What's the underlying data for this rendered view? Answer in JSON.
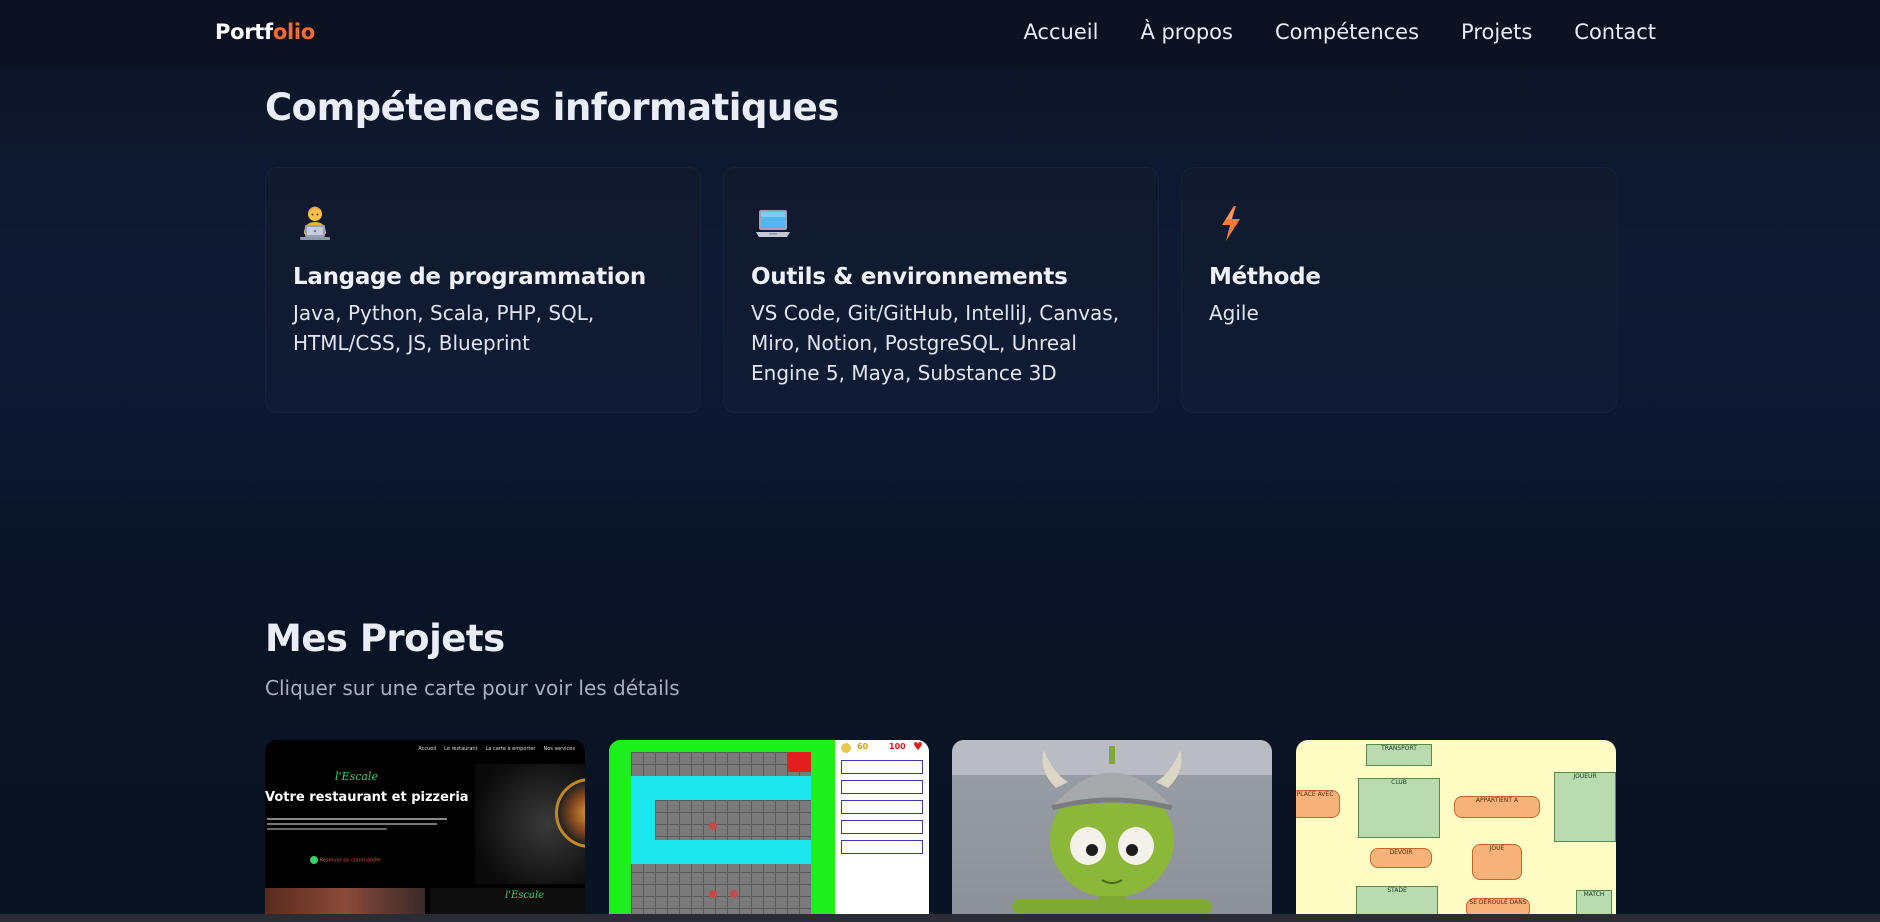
{
  "nav": {
    "logo_part1": "Portf",
    "logo_part2": "olio",
    "links": [
      "Accueil",
      "À propos",
      "Compétences",
      "Projets",
      "Contact"
    ]
  },
  "skills": {
    "title": "Compétences informatiques",
    "cards": [
      {
        "icon": "technologist-icon",
        "title": "Langage de programmation",
        "text": "Java, Python, Scala, PHP, SQL, HTML/CSS, JS, Blueprint"
      },
      {
        "icon": "laptop-icon",
        "title": "Outils & environnements",
        "text": "VS Code, Git/GitHub, IntelliJ, Canvas, Miro, Notion, PostgreSQL, Unreal Engine 5, Maya, Substance 3D"
      },
      {
        "icon": "lightning-icon",
        "title": "Méthode",
        "text": "Agile"
      }
    ]
  },
  "projects": {
    "title": "Mes Projets",
    "subtitle": "Cliquer sur une carte pour voir les détails",
    "thumb_restaurant": {
      "nav": [
        "Accueil",
        "Le restaurant",
        "La carte à emporter",
        "Nos services"
      ],
      "logo": "l'Escale",
      "heading": "Votre restaurant et pizzeria",
      "cta": "Réserver ou commander",
      "logo2": "l'Escale"
    },
    "thumb_game": {
      "coins": "60",
      "health": "100"
    },
    "thumb_diagram": {
      "entities": [
        "TRANSPORT",
        "CLUB",
        "JOUEUR",
        "STADE",
        "MATCH"
      ],
      "relations": [
        "APPARTIENT A",
        "JOUE",
        "SE DÉROULE DANS",
        "DEVOIR",
        "PLACE AVEC"
      ]
    }
  },
  "colors": {
    "accent": "#ff6b2c",
    "background": "#0b1120",
    "card": "#111a2c"
  }
}
